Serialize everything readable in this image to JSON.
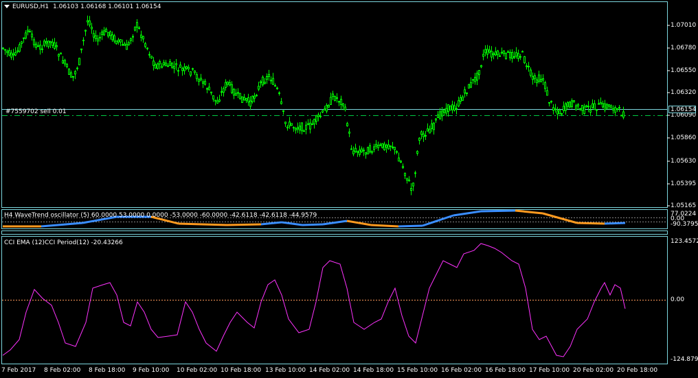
{
  "header": {
    "symbol": "EURUSD,H1",
    "ohlc": "1.06103 1.06168 1.06101 1.06154"
  },
  "order_label": "#7559702 sell 0.01",
  "current_price": "1.06154",
  "price_axis": [
    "1.07010",
    "1.06780",
    "1.06550",
    "1.06320",
    "1.06090",
    "1.05860",
    "1.05630",
    "1.05395",
    "1.05165"
  ],
  "wavetrend": {
    "label": "H4 WaveTrend oscillator (5) 60.0000 53.0000 0.0000 -53.0000 -60.0000 -42.6118 -42.6118 -44.9579",
    "axis": [
      "77.0224",
      "0.00",
      "-90.3795"
    ]
  },
  "cci": {
    "label": "CCI EMA (12)CCI Period(12) -20.43266",
    "axis": [
      "123.4572",
      "0.00",
      "-124.8793"
    ]
  },
  "dates": [
    "7 Feb 2017",
    "8 Feb 02:00",
    "8 Feb 18:00",
    "9 Feb 10:00",
    "10 Feb 02:00",
    "10 Feb 18:00",
    "13 Feb 10:00",
    "14 Feb 02:00",
    "14 Feb 18:00",
    "15 Feb 10:00",
    "16 Feb 02:00",
    "16 Feb 18:00",
    "17 Feb 10:00",
    "20 Feb 02:00",
    "20 Feb 18:00"
  ],
  "colors": {
    "frame": "#7dd8e0",
    "candles": "#00ff00",
    "wt_up": "#3a8dff",
    "wt_down": "#ff9a1f",
    "cci": "#ff33ff"
  },
  "icons": [
    "dropdown-triangle-icon"
  ]
}
